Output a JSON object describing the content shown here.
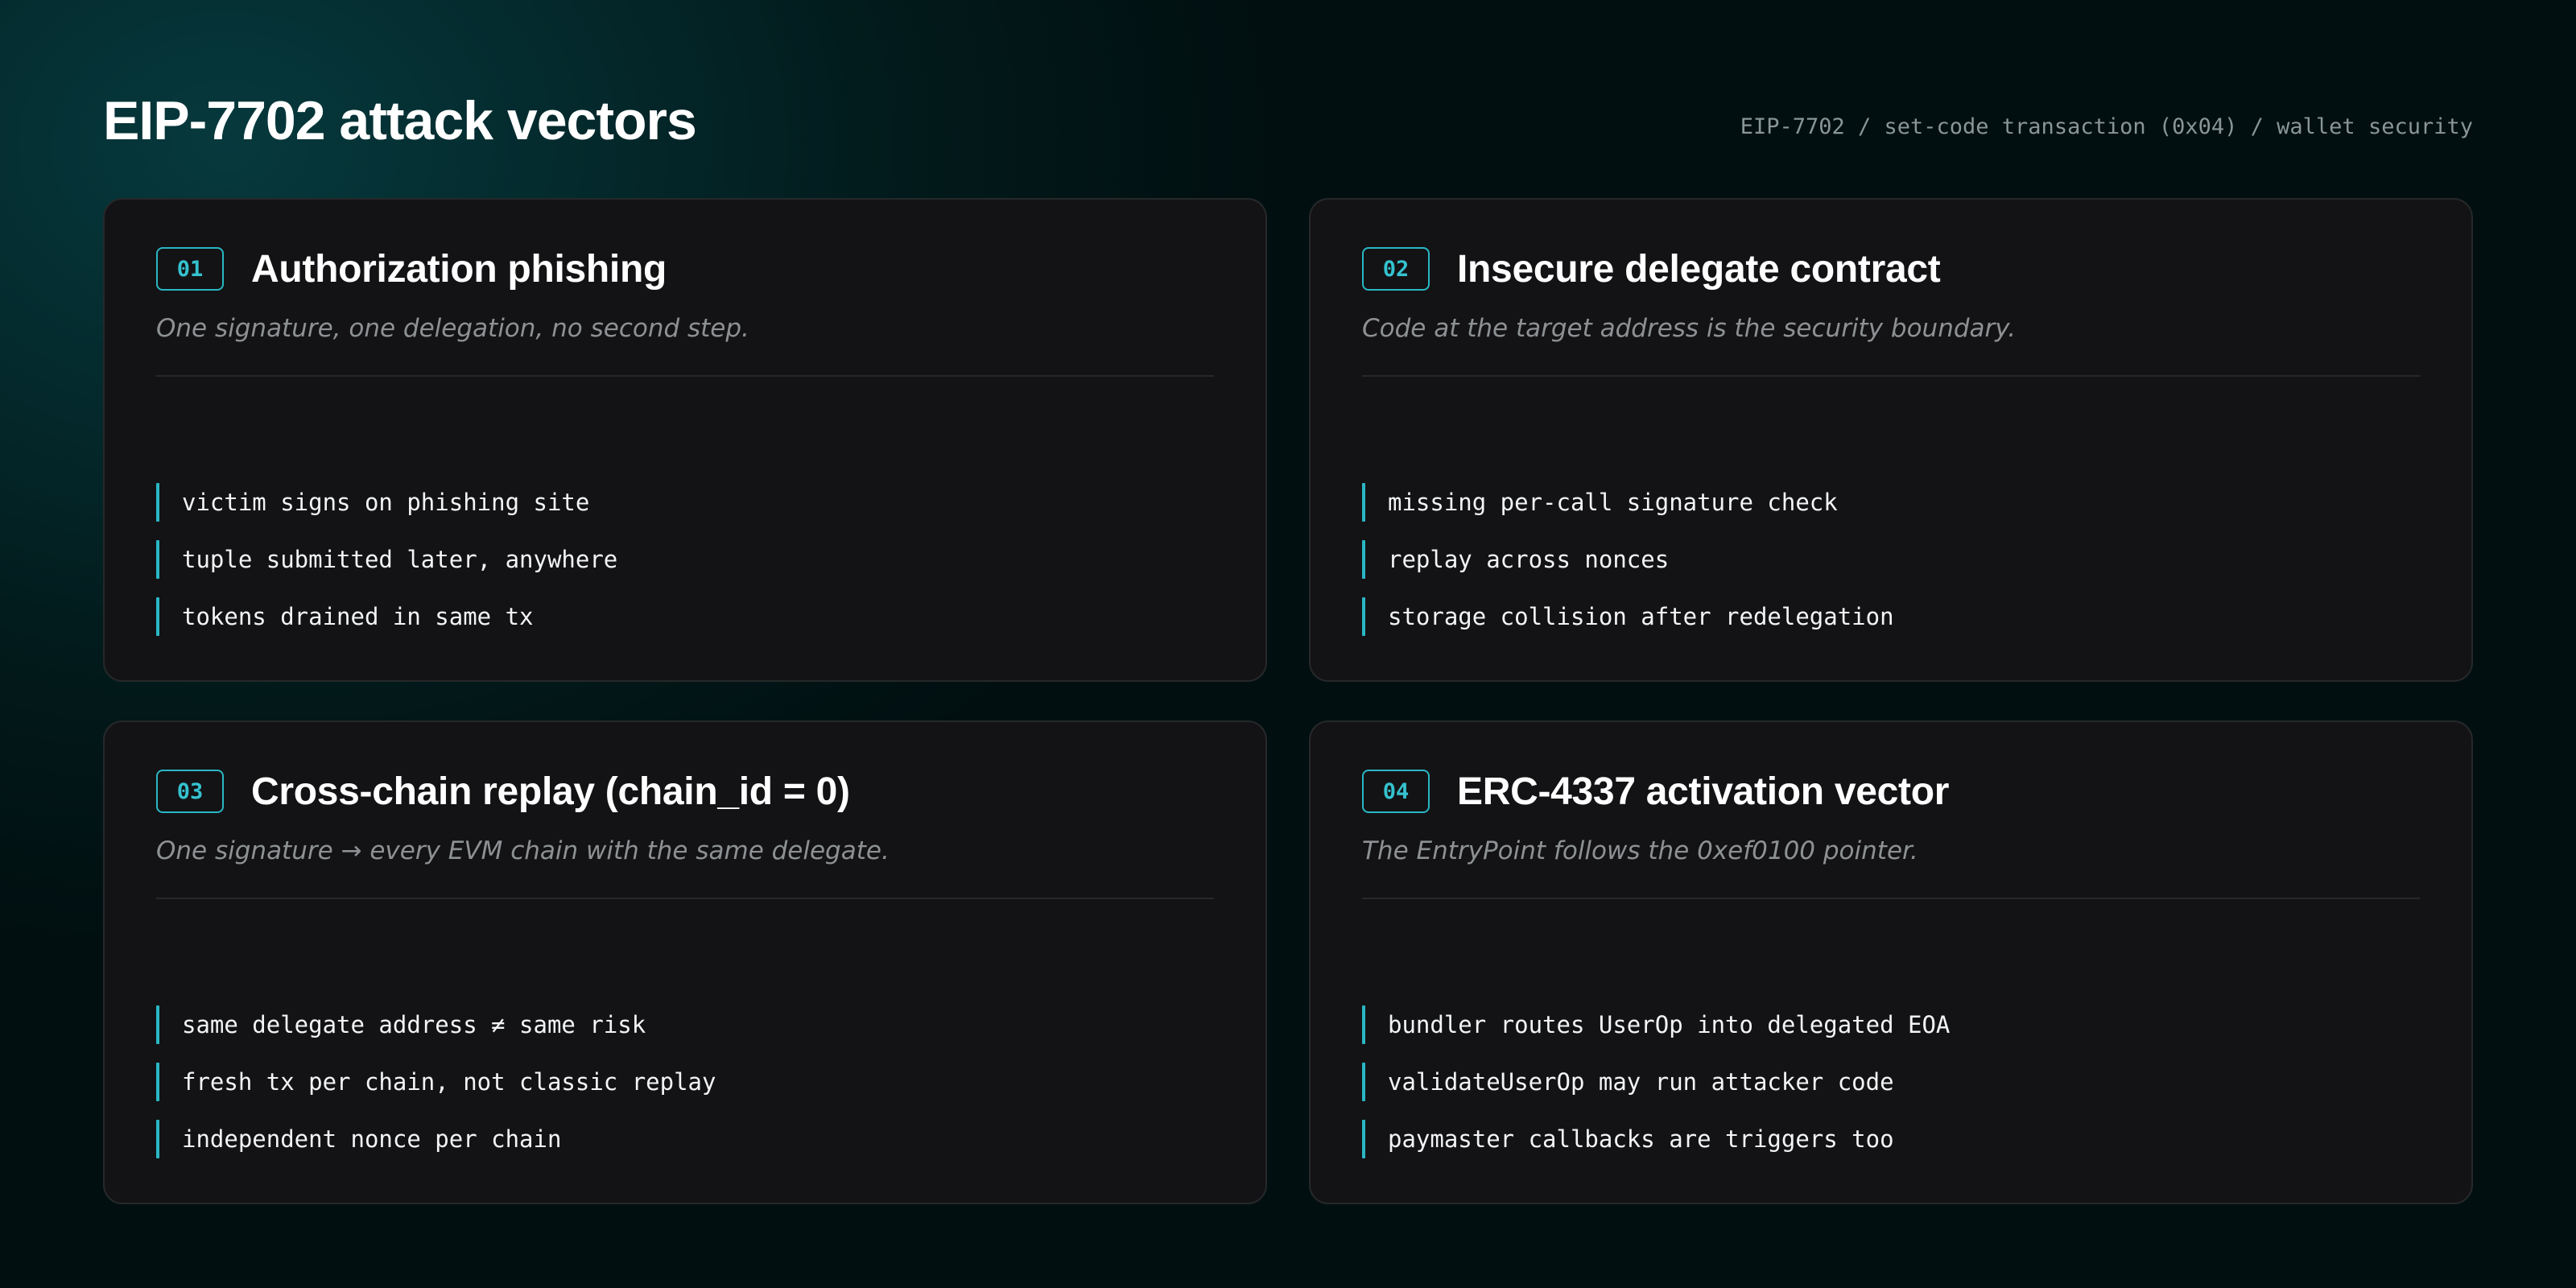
{
  "header": {
    "title": "EIP-7702 attack vectors",
    "breadcrumb": "EIP-7702 / set-code transaction (0x04) / wallet security"
  },
  "colors": {
    "accent": "#2ab7c4",
    "card_background": "#131315",
    "page_background": "#021a1b"
  },
  "cards": [
    {
      "number": "01",
      "title": "Authorization phishing",
      "subtitle": "One signature, one delegation, no second step.",
      "items": [
        "victim signs on phishing site",
        "tuple submitted later, anywhere",
        "tokens drained in same tx"
      ]
    },
    {
      "number": "02",
      "title": "Insecure delegate contract",
      "subtitle": "Code at the target address is the security boundary.",
      "items": [
        "missing per-call signature check",
        "replay across nonces",
        "storage collision after redelegation"
      ]
    },
    {
      "number": "03",
      "title": "Cross-chain replay (chain_id = 0)",
      "subtitle": "One signature → every EVM chain with the same delegate.",
      "items": [
        "same delegate address ≠ same risk",
        "fresh tx per chain, not classic replay",
        "independent nonce per chain"
      ]
    },
    {
      "number": "04",
      "title": "ERC-4337 activation vector",
      "subtitle": "The EntryPoint follows the 0xef0100 pointer.",
      "items": [
        "bundler routes UserOp into delegated EOA",
        "validateUserOp may run attacker code",
        "paymaster callbacks are triggers too"
      ]
    }
  ]
}
